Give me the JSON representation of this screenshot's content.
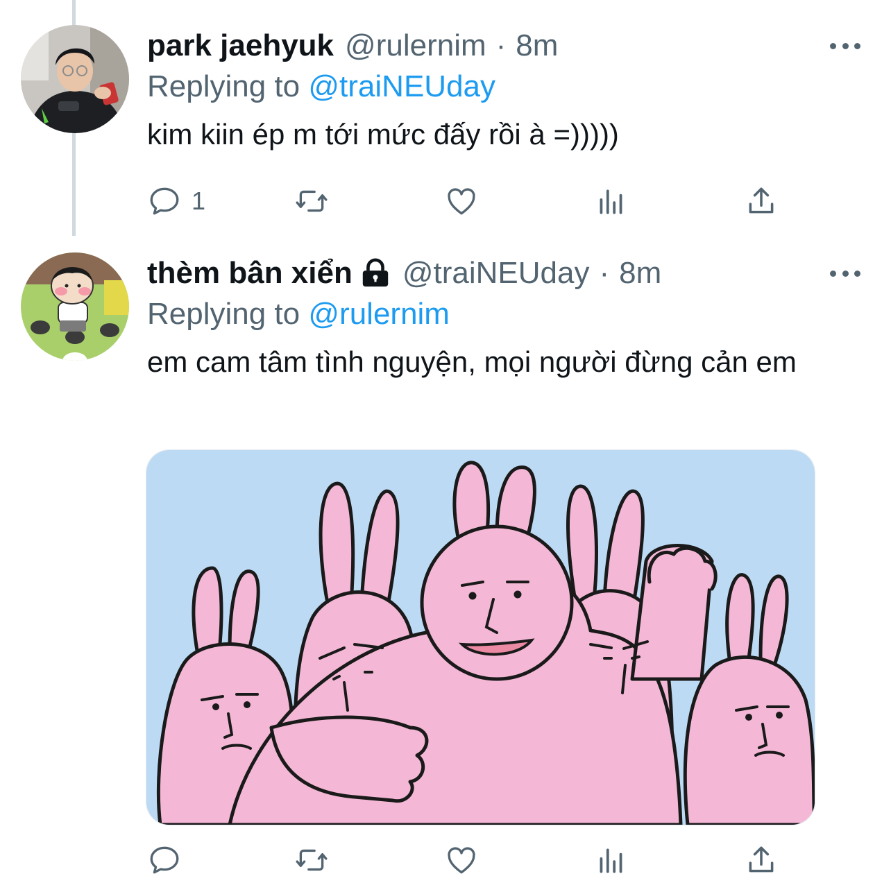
{
  "colors": {
    "text": "#0f1419",
    "secondary": "#536471",
    "link": "#1d9bf0",
    "thread_line": "#cfd9de"
  },
  "tweets": [
    {
      "display_name": "park jaehyuk",
      "handle": "@rulernim",
      "separator": "·",
      "time": "8m",
      "replying_prefix": "Replying to",
      "replying_to": "@traiNEUday",
      "text": "kim kiin ép m tới mức đấy rồi à =)))))",
      "reply_count": "1",
      "protected": false,
      "icons": [
        "reply-icon",
        "retweet-icon",
        "like-icon",
        "views-icon",
        "share-icon",
        "more-icon"
      ]
    },
    {
      "display_name": "thèm bân xiển",
      "handle": "@traiNEUday",
      "separator": "·",
      "time": "8m",
      "replying_prefix": "Replying to",
      "replying_to": "@rulernim",
      "text": "em cam tâm tình nguyện, mọi người đừng cản em",
      "reply_count": "",
      "protected": true,
      "icons": [
        "lock-icon",
        "reply-icon",
        "retweet-icon",
        "like-icon",
        "views-icon",
        "share-icon",
        "more-icon"
      ]
    }
  ]
}
